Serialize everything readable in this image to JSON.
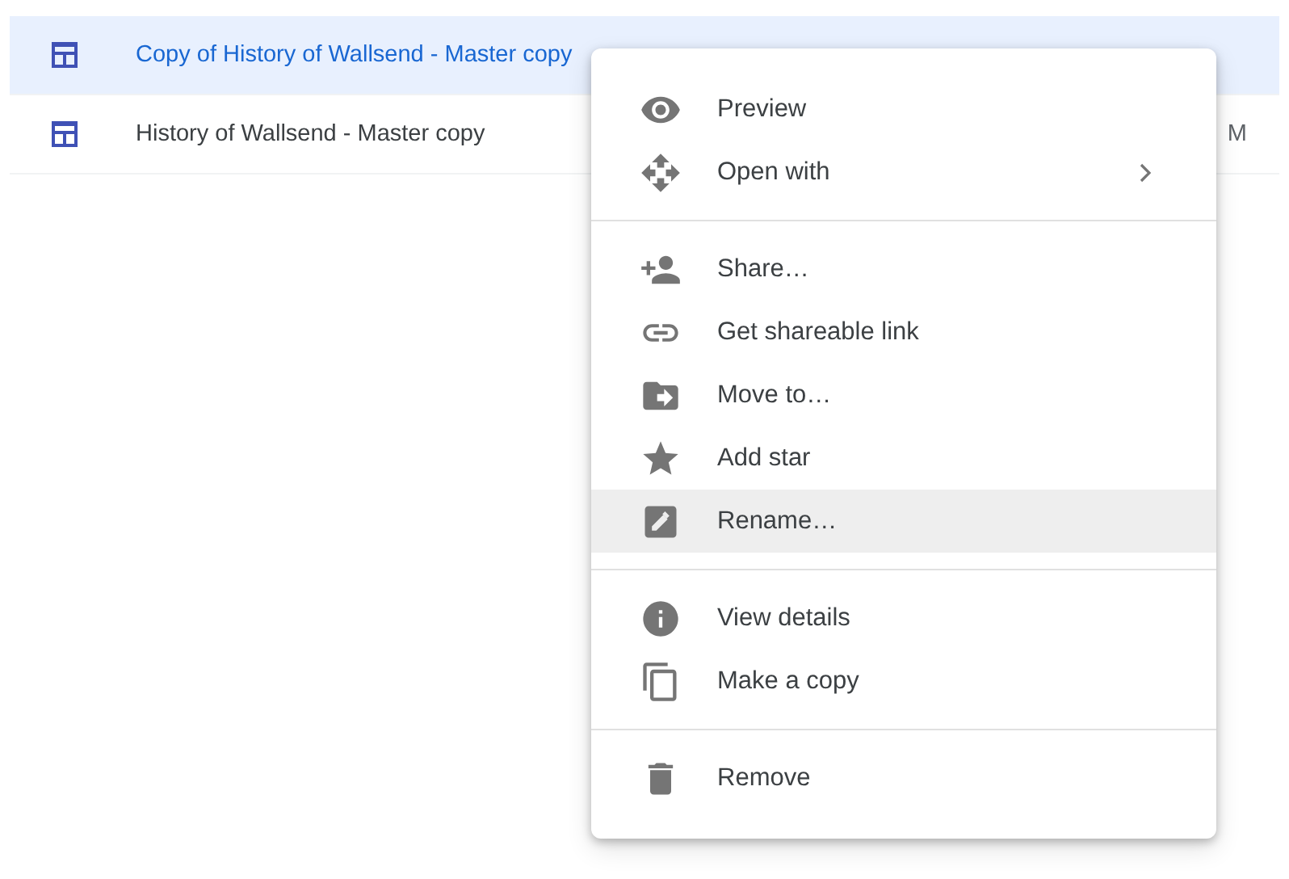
{
  "files": [
    {
      "name": "Copy of History of Wallsend - Master copy",
      "selected": true
    },
    {
      "name": "History of Wallsend - Master copy",
      "selected": false,
      "column_3": "M"
    }
  ],
  "context_menu": {
    "sections": [
      [
        {
          "label": "Preview",
          "submenu": false,
          "selected": false
        },
        {
          "label": "Open with",
          "submenu": true,
          "selected": false
        }
      ],
      [
        {
          "label": "Share…",
          "submenu": false,
          "selected": false
        },
        {
          "label": "Get shareable link",
          "submenu": false,
          "selected": false
        },
        {
          "label": "Move to…",
          "submenu": false,
          "selected": false
        },
        {
          "label": "Add star",
          "submenu": false,
          "selected": false
        },
        {
          "label": "Rename…",
          "submenu": false,
          "selected": true
        }
      ],
      [
        {
          "label": "View details",
          "submenu": false,
          "selected": false
        },
        {
          "label": "Make a copy",
          "submenu": false,
          "selected": false
        }
      ],
      [
        {
          "label": "Remove",
          "submenu": false,
          "selected": false
        }
      ]
    ]
  }
}
